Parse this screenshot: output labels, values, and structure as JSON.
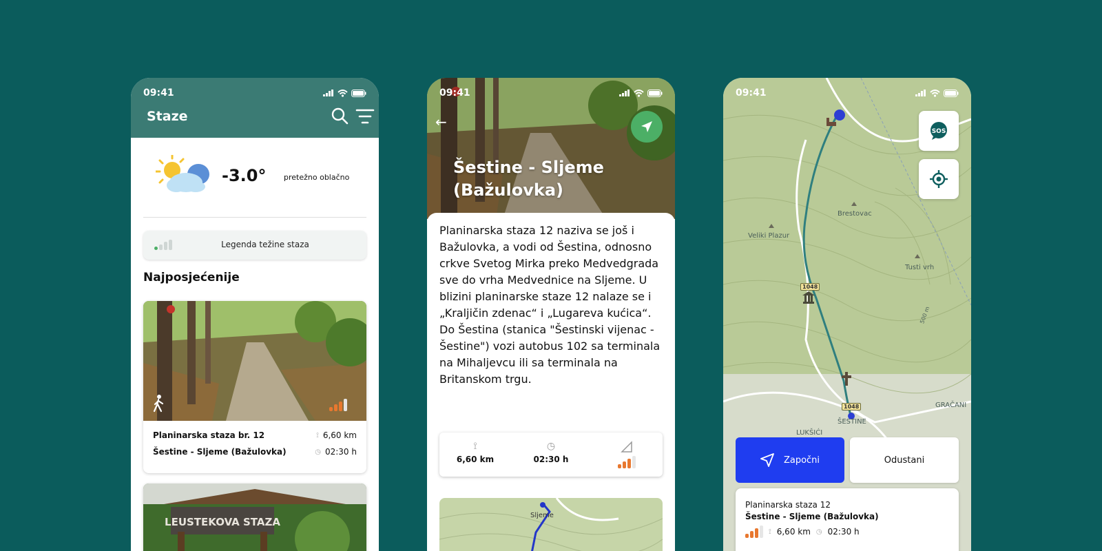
{
  "phone1": {
    "status_time": "09:41",
    "title": "Staze",
    "weather": {
      "temperature": "-3.0°",
      "description": "pretežno oblačno"
    },
    "legend_label": "Legenda težine staza",
    "section_title": "Najposjećenije",
    "card1": {
      "name": "Planinarska staza br. 12",
      "route": "Šestine - Sljeme (Bažulovka)",
      "distance": "6,60 km",
      "duration": "02:30 h"
    },
    "card2": {
      "sign_text": "LEUSTEKOVA STAZA"
    }
  },
  "phone2": {
    "status_time": "09:41",
    "title": "Šestine - Sljeme (Bažulovka)",
    "description": "Planinarska staza 12 naziva se još i Bažulovka, a vodi od Šestina, odnosno crkve Svetog Mirka preko Medvedgrada sve do vrha Medvednice na Sljeme. U blizini planinarske staze 12 nalaze se i „Kraljičin zdenac“ i „Lugareva kućica“. Do Šestina (stanica \"Šestinski vijenac - Šestine\") vozi autobus 102 sa terminala na Mihaljevcu ili sa terminala na Britanskom trgu.",
    "stats": {
      "distance": "6,60 km",
      "duration": "02:30 h"
    },
    "minimap_label": "Sljeme"
  },
  "phone3": {
    "status_time": "09:41",
    "map_labels": {
      "veliki_plazur": "Veliki Plazur",
      "brestovac": "Brestovac",
      "tusti_vrh": "Tusti vrh",
      "sestine": "ŠESTINE",
      "luksici": "LUKŠIĆI",
      "gracani": "GRAČANI",
      "contour": "500 m",
      "road_1": "1048",
      "road_2": "1048"
    },
    "sos_label": "SOS",
    "start_label": "Započni",
    "cancel_label": "Odustani",
    "info": {
      "line1": "Planinarska staza 12",
      "line2": "Šestine - Sljeme (Bažulovka)",
      "distance": "6,60 km",
      "duration": "02:30 h"
    }
  },
  "colors": {
    "background": "#0b5c5c",
    "header": "#3b7b74",
    "difficulty_active": "#e8782f",
    "difficulty_inactive": "#cfd6d4",
    "nav_button": "#4caf66",
    "start_button": "#1f3df0",
    "trail": "#2f7f7f"
  },
  "difficulty": {
    "level": 3,
    "max": 4
  }
}
